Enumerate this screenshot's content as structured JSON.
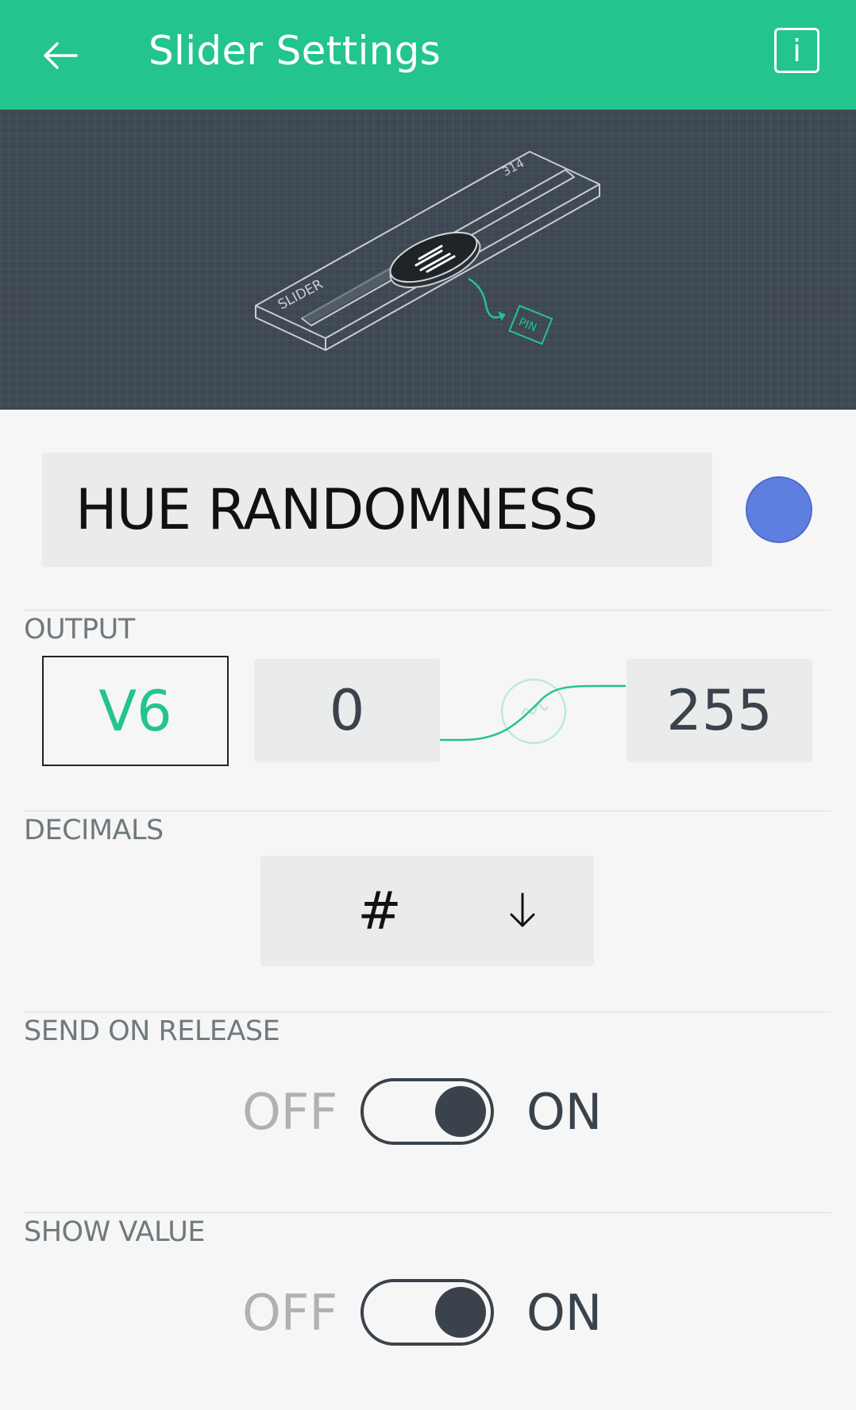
{
  "appbar": {
    "title": "Slider Settings",
    "back_icon": "arrow-left-icon",
    "info_label": "i"
  },
  "hero": {
    "illustration": "slider-illustration",
    "slider_text": "SLIDER",
    "value_text": "314",
    "pin_text": "PIN"
  },
  "widget": {
    "name": "HUE RANDOMNESS",
    "color": "#5f7fe0"
  },
  "output": {
    "label": "OUTPUT",
    "pin": "V6",
    "min": "0",
    "max": "255"
  },
  "decimals": {
    "label": "DECIMALS",
    "value": "#"
  },
  "send_on_release": {
    "label": "SEND ON RELEASE",
    "off_label": "OFF",
    "on_label": "ON",
    "state": "on"
  },
  "show_value": {
    "label": "SHOW VALUE",
    "off_label": "OFF",
    "on_label": "ON",
    "state": "on"
  },
  "colors": {
    "accent": "#23c48e",
    "dark": "#3a434b",
    "hero_bg": "#3e4852"
  }
}
